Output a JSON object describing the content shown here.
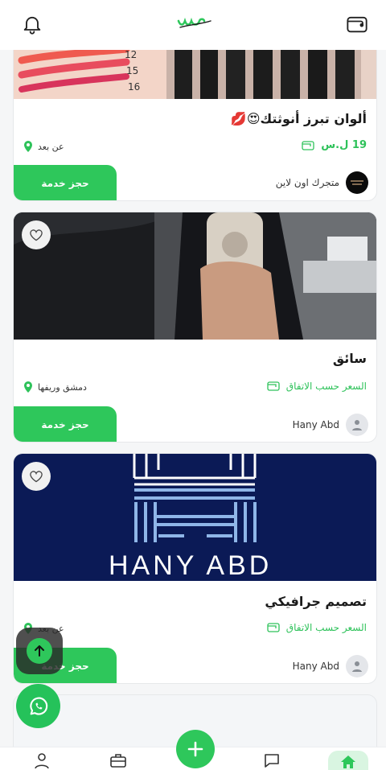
{
  "header": {
    "logo_text": "ws"
  },
  "cards": [
    {
      "title": "ألوان تبرز أنوثتك😍💋",
      "price": "19 ل.س",
      "location": "عن بعد",
      "book_label": "حجز خدمة",
      "owner": "متجرك اون لاين",
      "image_numbers": [
        "12",
        "15",
        "16"
      ]
    },
    {
      "title": "سائق",
      "price": "السعر حسب الاتفاق",
      "location": "دمشق وريفها",
      "book_label": "حجز خدمة",
      "owner": "Hany Abd"
    },
    {
      "title": "تصميم جرافيكي",
      "price": "السعر حسب الاتفاق",
      "location": "عن بعد",
      "book_label": "حجز خدمة",
      "owner": "Hany Abd",
      "image_text": "HANY ABD"
    }
  ],
  "colors": {
    "accent": "#2ec75b",
    "logo_blue": "#0b1a56"
  }
}
